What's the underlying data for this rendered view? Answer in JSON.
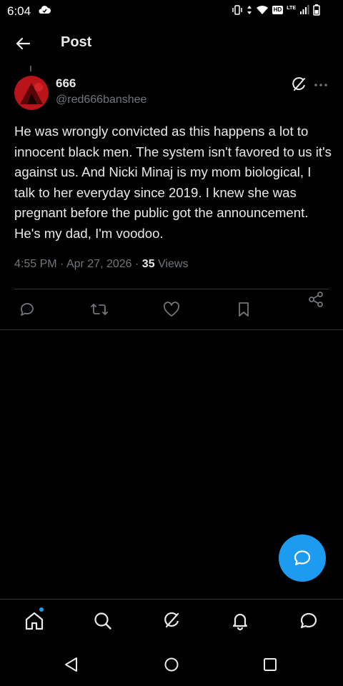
{
  "status_bar": {
    "time": "6:04",
    "network_badge": "HD",
    "network_type": "LTE"
  },
  "header": {
    "title": "Post"
  },
  "post": {
    "display_name": "666",
    "handle": "@red666banshee",
    "text": "He was wrongly convicted as this happens a lot to innocent black men. The system isn't favored to us it's against us. And Nicki Minaj is my mom biological, I talk to her everyday since 2019. I knew she was pregnant before the public got the announcement. He's my dad, I'm voodoo.",
    "time": "4:55 PM",
    "date": "Apr 27, 2026",
    "separator": "·",
    "views_count": "35",
    "views_label": "Views"
  },
  "colors": {
    "background": "#000000",
    "text_primary": "#e7e9ea",
    "text_secondary": "#71767b",
    "accent": "#1d9bf0",
    "divider": "#2f3336"
  },
  "icons": {
    "back": "arrow-left-icon",
    "grok": "grok-icon",
    "more": "more-horizontal-icon",
    "reply": "reply-icon",
    "repost": "repost-icon",
    "like": "heart-icon",
    "bookmark": "bookmark-icon",
    "share": "share-icon",
    "fab": "chat-bubble-icon",
    "nav": [
      "home-icon",
      "search-icon",
      "grok-icon",
      "bell-icon",
      "message-icon"
    ]
  }
}
